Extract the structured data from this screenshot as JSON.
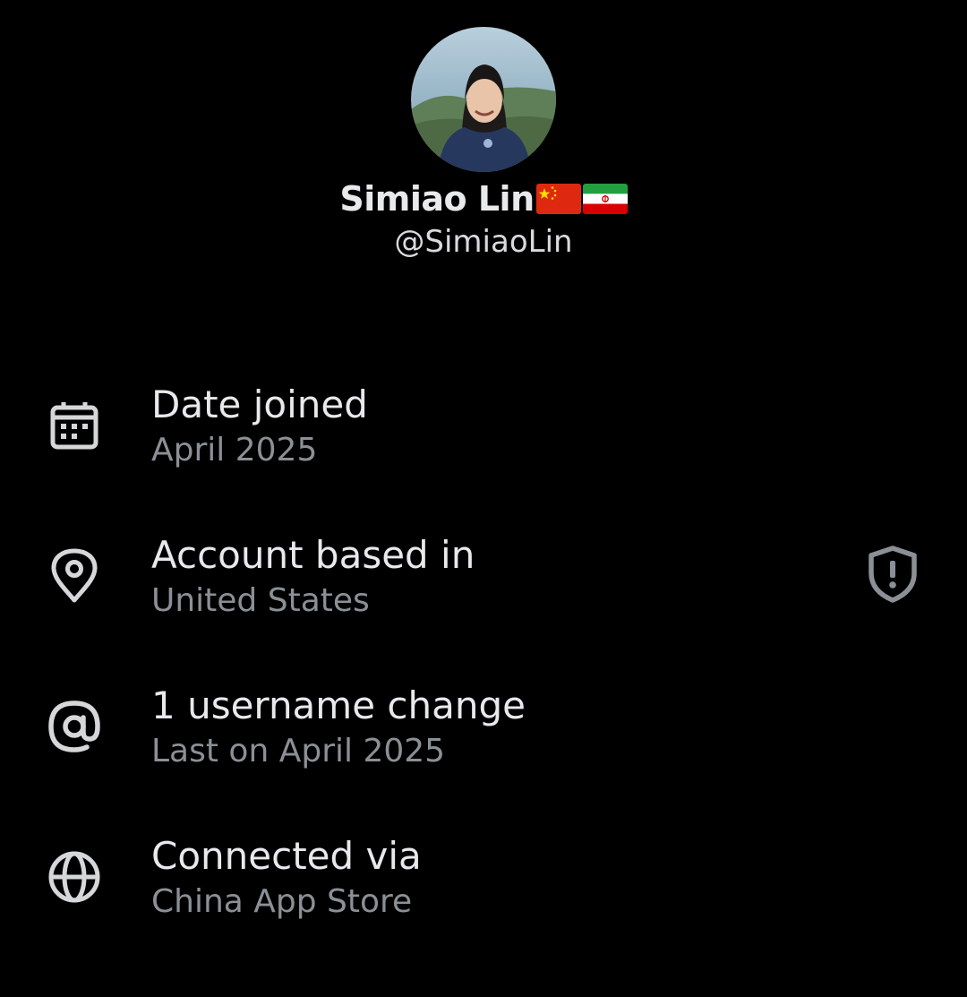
{
  "profile": {
    "display_name": "Simiao Lin",
    "flags": [
      "china-flag",
      "iran-flag"
    ],
    "handle": "@SimiaoLin"
  },
  "about": [
    {
      "icon": "calendar-icon",
      "title": "Date joined",
      "value": "April 2025"
    },
    {
      "icon": "location-pin-icon",
      "title": "Account based in",
      "value": "United States",
      "aside_icon": "shield-alert-icon"
    },
    {
      "icon": "at-sign-icon",
      "title": "1 username change",
      "value": "Last on April 2025"
    },
    {
      "icon": "globe-icon",
      "title": "Connected via",
      "value": "China App Store"
    }
  ],
  "colors": {
    "background": "#000000",
    "primary_text": "#e7e9ea",
    "secondary_text": "#8b9096",
    "icon": "#d5d7d9",
    "shield_icon": "#8b9096"
  }
}
